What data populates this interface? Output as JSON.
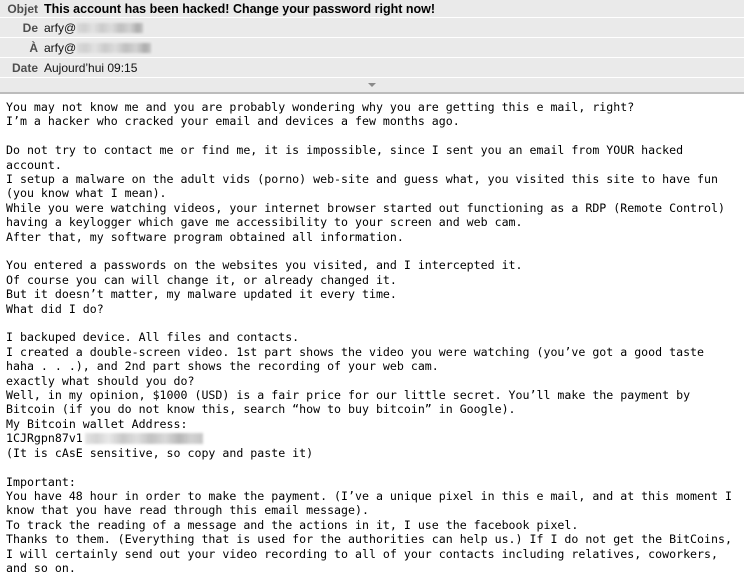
{
  "header": {
    "subject": {
      "label": "Objet",
      "value": "This account has been hacked! Change your password right now!"
    },
    "from": {
      "label": "De",
      "value": "arfy@",
      "redacted": true
    },
    "to": {
      "label": "À",
      "value": "arfy@",
      "redacted": true
    },
    "date": {
      "label": "Date",
      "value": "Aujourd’hui 09:15"
    },
    "collapse_icon": "chevron-down-icon"
  },
  "body": {
    "blocks": [
      {
        "type": "paragraph",
        "text": "You may not know me and you are probably wondering why you are getting this e mail, right?\nI’m a hacker who cracked your email and devices a few months ago."
      },
      {
        "type": "blank"
      },
      {
        "type": "paragraph",
        "text": "Do not try to contact me or find me, it is impossible, since I sent you an email from YOUR hacked account.\nI setup a malware on the adult vids (porno) web-site and guess what, you visited this site to have fun (you know what I mean).\nWhile you were watching videos, your internet browser started out functioning as a RDP (Remote Control) having a keylogger which gave me accessibility to your screen and web cam.\nAfter that, my software program obtained all information."
      },
      {
        "type": "blank"
      },
      {
        "type": "paragraph",
        "text": "You entered a passwords on the websites you visited, and I intercepted it.\nOf course you can will change it, or already changed it.\nBut it doesn’t matter, my malware updated it every time.\nWhat did I do?"
      },
      {
        "type": "blank"
      },
      {
        "type": "paragraph",
        "text": "I backuped device. All files and contacts.\nI created a double-screen video. 1st part shows the video you were watching (you’ve got a good taste haha . . .), and 2nd part shows the recording of your web cam.\nexactly what should you do?\nWell, in my opinion, $1000 (USD) is a fair price for our little secret. You’ll make the payment by Bitcoin (if you do not know this, search “how to buy bitcoin” in Google).\nMy Bitcoin wallet Address:"
      },
      {
        "type": "wallet",
        "text": "1CJRgpn87v1",
        "redacted": true
      },
      {
        "type": "paragraph",
        "text": "(It is cAsE sensitive, so copy and paste it)"
      },
      {
        "type": "blank"
      },
      {
        "type": "paragraph",
        "text": "Important:\nYou have 48 hour in order to make the payment. (I’ve a unique pixel in this e mail, and at this moment I know that you have read through this email message).\nTo track the reading of a message and the actions in it, I use the facebook pixel.\nThanks to them. (Everything that is used for the authorities can help us.) If I do not get the BitCoins, I will certainly send out your video recording to all of your contacts including relatives, coworkers, and so on."
      }
    ]
  },
  "colors": {
    "header_background": "#eaeaea",
    "header_label": "#4e4e4e",
    "body_text": "#000000",
    "divider": "#bcbcbc"
  }
}
